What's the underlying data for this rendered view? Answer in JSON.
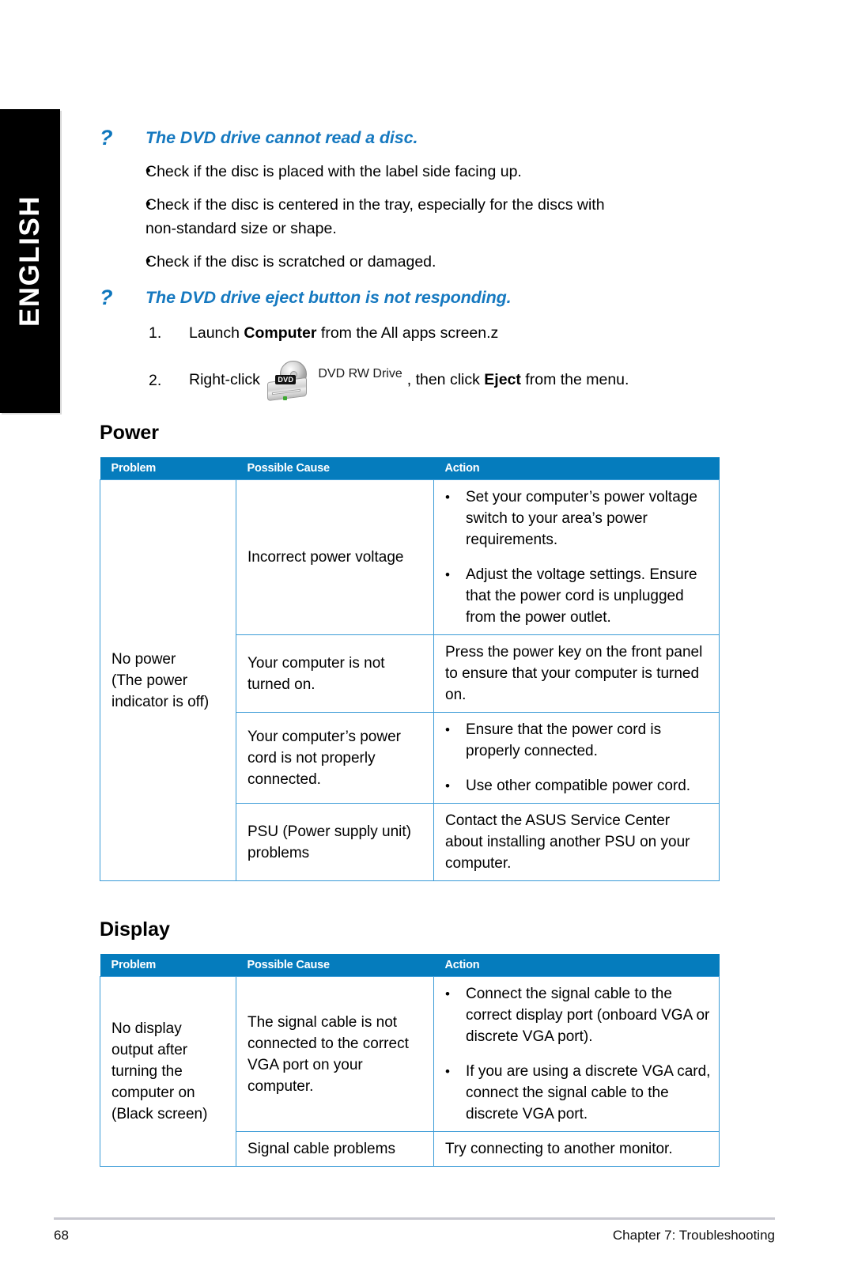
{
  "language_tab": {
    "label": "ENGLISH"
  },
  "qa_sections": [
    {
      "marker": "?",
      "title": "The DVD drive cannot read a disc.",
      "list_type": "bullets",
      "items": [
        "Check if the disc is placed with the label side facing up.",
        "Check if the disc is centered in the tray, especially for the discs with non-standard size or shape.",
        "Check if the disc is scratched or damaged."
      ],
      "bullet_char": "•"
    },
    {
      "marker": "?",
      "title": "The DVD drive eject button is not responding.",
      "list_type": "steps",
      "steps": [
        {
          "number": "1.",
          "text_before": "Launch ",
          "bold": "Computer",
          "text_after": " from the All apps screen.z"
        },
        {
          "number": "2.",
          "text_before": "Right-click ",
          "icon": "dvd-rw-drive-icon",
          "icon_label": "DVD RW Drive",
          "text_middle": ", then click ",
          "bold": "Eject",
          "text_after": " from the menu."
        }
      ]
    }
  ],
  "tables": [
    {
      "heading": "Power",
      "columns": [
        "Problem",
        "Possible Cause",
        "Action"
      ],
      "rows": [
        {
          "problem": "No power\n(The power\nindicator is off)",
          "problem_rowspan": 4,
          "cause": "Incorrect power voltage",
          "action_type": "bullets",
          "action": [
            "Set your computer’s power voltage switch to your area’s power requirements.",
            "Adjust the voltage settings. Ensure that the power cord is unplugged from the power outlet."
          ]
        },
        {
          "cause": "Your computer is not turned on.",
          "action_type": "plain",
          "action": "Press the power key on the front panel to ensure that your computer is turned on."
        },
        {
          "cause": "Your computer’s power cord is not properly connected.",
          "action_type": "bullets",
          "action": [
            "Ensure that the power cord is properly connected.",
            "Use other compatible power cord."
          ]
        },
        {
          "cause": "PSU (Power supply unit) problems",
          "action_type": "plain",
          "action": "Contact the ASUS Service Center about installing another PSU on your computer."
        }
      ]
    },
    {
      "heading": "Display",
      "columns": [
        "Problem",
        "Possible Cause",
        "Action"
      ],
      "rows": [
        {
          "problem": "No display\noutput after\nturning the\ncomputer on\n(Black screen)",
          "problem_rowspan": 2,
          "cause": "The signal cable is not connected to the correct VGA port on your computer.",
          "action_type": "bullets",
          "action": [
            "Connect the signal cable to the correct display port (onboard VGA or discrete VGA port).",
            "If you are using a discrete VGA card, connect the signal cable to the discrete VGA port."
          ]
        },
        {
          "cause": "Signal cable problems",
          "action_type": "plain",
          "action": "Try connecting to another monitor."
        }
      ]
    }
  ],
  "footer": {
    "page_number": "68",
    "chapter": "Chapter 7: Troubleshooting"
  },
  "colors": {
    "heading_blue": "#1679c0",
    "table_header_blue": "#057cbd",
    "table_border_blue": "#3b9bd7",
    "tab_black": "#000000",
    "footer_rule": "#c8c8d0"
  }
}
